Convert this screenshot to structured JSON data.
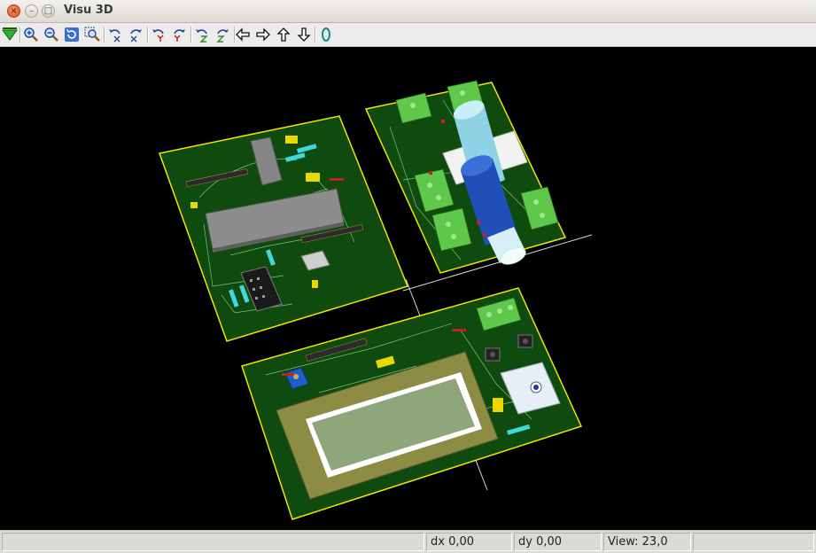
{
  "window": {
    "title": "Visu 3D"
  },
  "toolbar": {
    "buttons": [
      {
        "icon": "reload-board-icon"
      },
      {
        "icon": "zoom-in-icon"
      },
      {
        "icon": "zoom-out-icon"
      },
      {
        "icon": "refresh-view-icon"
      },
      {
        "icon": "zoom-fit-icon"
      },
      {
        "icon": "rotate-x-neg-icon"
      },
      {
        "icon": "rotate-x-pos-icon"
      },
      {
        "icon": "rotate-y-neg-icon"
      },
      {
        "icon": "rotate-y-pos-icon"
      },
      {
        "icon": "rotate-z-neg-icon"
      },
      {
        "icon": "rotate-z-pos-icon"
      },
      {
        "icon": "arrow-left-icon"
      },
      {
        "icon": "arrow-right-icon"
      },
      {
        "icon": "arrow-up-icon"
      },
      {
        "icon": "arrow-down-icon"
      },
      {
        "icon": "ortho-view-icon"
      }
    ]
  },
  "colors": {
    "pcb": "#0f4a0e",
    "outline": "#f2e500",
    "lcd_frame": "#8c8c45",
    "lcd_screen": "#8fa67a",
    "terminal": "#5fc84a",
    "background": "#000000"
  },
  "status": {
    "message": "",
    "dx": "dx 0,00",
    "dy": "dy 0,00",
    "view": "View: 23,0",
    "extra": ""
  }
}
